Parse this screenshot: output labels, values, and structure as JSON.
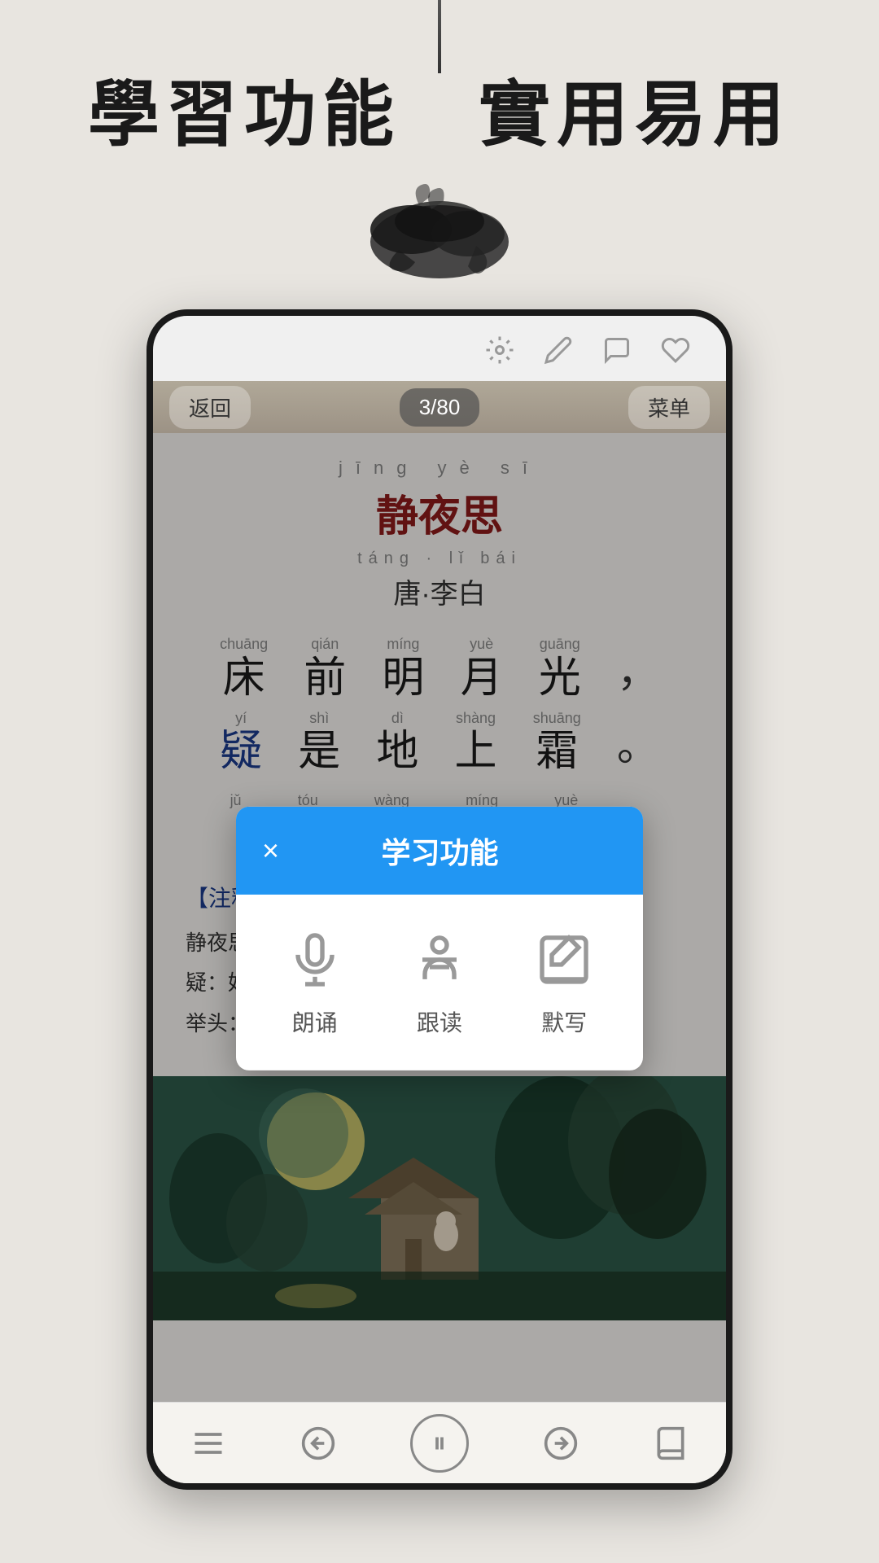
{
  "page": {
    "background_color": "#e8e5e0"
  },
  "top_section": {
    "title": "學習功能　實用易用",
    "ink_decoration": true
  },
  "phone": {
    "nav": {
      "back_label": "返回",
      "page_indicator": "3/80",
      "menu_label": "菜单"
    },
    "top_icons": [
      {
        "name": "settings-icon",
        "symbol": "gear"
      },
      {
        "name": "edit-icon",
        "symbol": "pen"
      },
      {
        "name": "comment-icon",
        "symbol": "comment"
      },
      {
        "name": "favorite-icon",
        "symbol": "heart"
      }
    ],
    "poem": {
      "title_pinyin": "jīng   yè   sī",
      "title": "静夜思",
      "author_pinyin": "táng · lǐ  bái",
      "author": "唐·李白",
      "lines": [
        {
          "chars": [
            {
              "pinyin": "chuāng",
              "hanzi": "床",
              "highlight": false
            },
            {
              "pinyin": "qián",
              "hanzi": "前",
              "highlight": false
            },
            {
              "pinyin": "míng",
              "hanzi": "明",
              "highlight": false
            },
            {
              "pinyin": "yuè",
              "hanzi": "月",
              "highlight": false
            },
            {
              "pinyin": "guāng",
              "hanzi": "光",
              "highlight": false
            }
          ],
          "punctuation": "，"
        },
        {
          "chars": [
            {
              "pinyin": "yí",
              "hanzi": "疑",
              "highlight": true
            },
            {
              "pinyin": "shì",
              "hanzi": "是",
              "highlight": false
            },
            {
              "pinyin": "dì",
              "hanzi": "地",
              "highlight": false
            },
            {
              "pinyin": "shàng",
              "hanzi": "上",
              "highlight": false
            },
            {
              "pinyin": "shuāng",
              "hanzi": "霜",
              "highlight": false
            }
          ],
          "punctuation": "。"
        }
      ],
      "partial_line": {
        "pinyin_row": [
          "jǔ",
          "tóu",
          "wàng",
          "míng",
          "yuè"
        ],
        "note": "partial visible"
      }
    },
    "notes": {
      "section_title": "【注释】",
      "items": [
        "静夜思",
        "疑：好像。以为。",
        "举头：抬头。"
      ]
    },
    "modal": {
      "title": "学习功能",
      "close_label": "×",
      "items": [
        {
          "icon": "microphone-icon",
          "label": "朗诵"
        },
        {
          "icon": "reading-icon",
          "label": "跟读"
        },
        {
          "icon": "writing-icon",
          "label": "默写"
        }
      ]
    },
    "bottom_nav": {
      "items": [
        {
          "icon": "menu-lines-icon",
          "label": ""
        },
        {
          "icon": "prev-icon",
          "label": ""
        },
        {
          "icon": "pause-icon",
          "label": ""
        },
        {
          "icon": "next-icon",
          "label": ""
        },
        {
          "icon": "book-icon",
          "label": ""
        }
      ]
    }
  }
}
